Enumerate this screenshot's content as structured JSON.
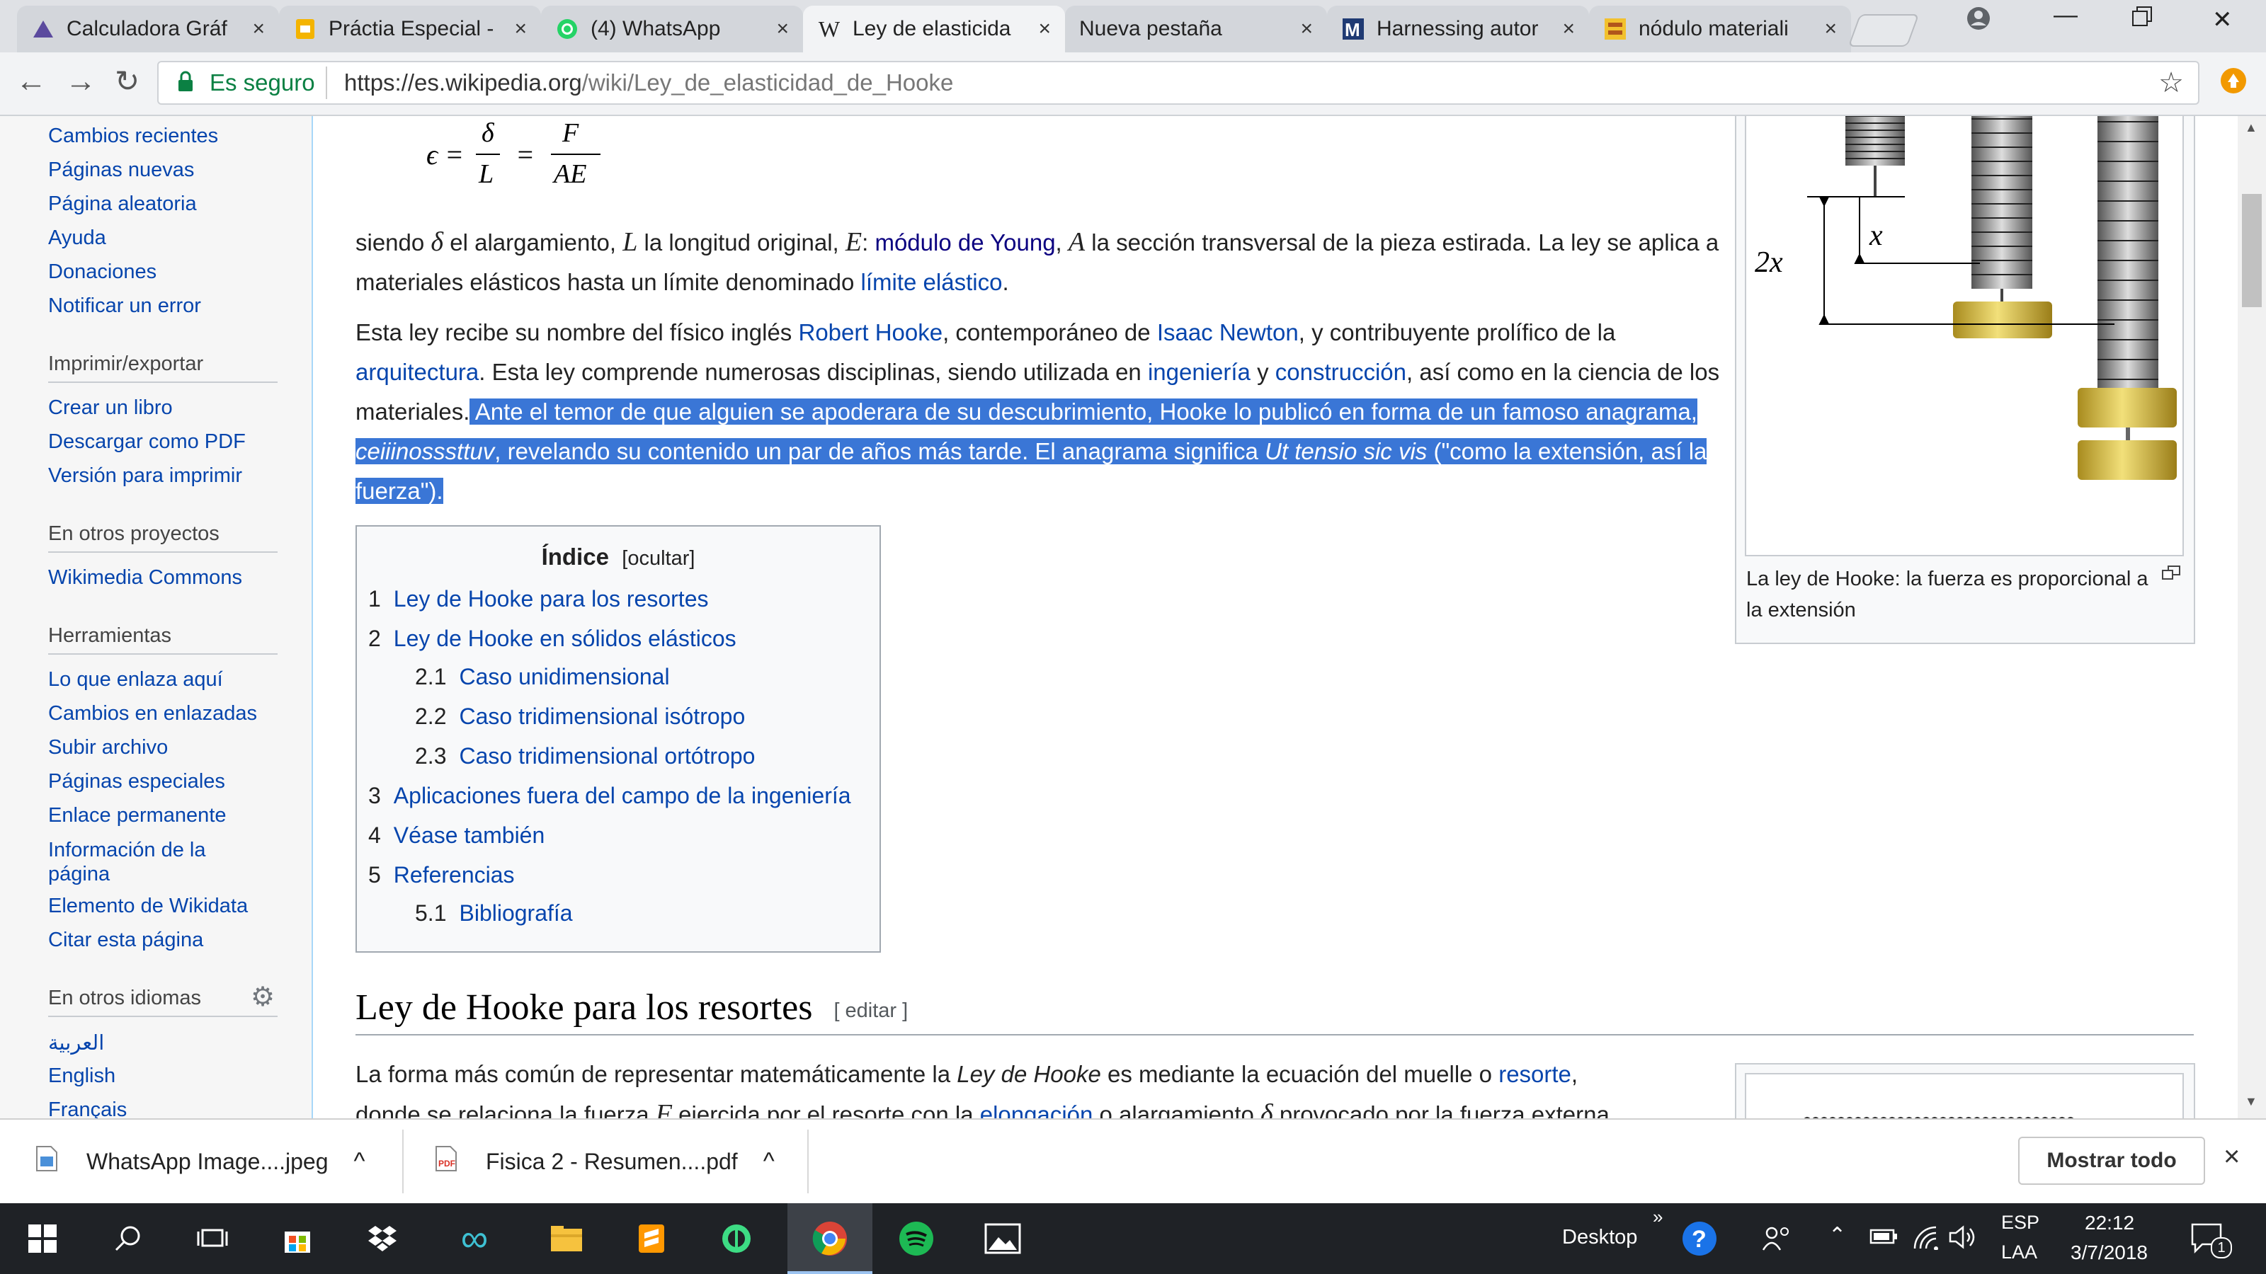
{
  "browser": {
    "tabs": [
      {
        "title": "Calculadora Gráf",
        "icon": "desmos-icon"
      },
      {
        "title": "Práctia Especial -",
        "icon": "slides-icon"
      },
      {
        "title": "(4) WhatsApp",
        "icon": "whatsapp-icon"
      },
      {
        "title": "Ley de elasticida",
        "icon": "wikipedia-icon",
        "active": true
      },
      {
        "title": "Nueva pestaña",
        "icon": ""
      },
      {
        "title": "Harnessing autor",
        "icon": "mdpi-icon"
      },
      {
        "title": "nódulo materiali",
        "icon": "nodmat-icon"
      }
    ],
    "secure_label": "Es seguro",
    "url_host": "https://es.wikipedia.org",
    "url_path": "/wiki/Ley_de_elasticidad_de_Hooke",
    "close_glyph": "×"
  },
  "sidebar": {
    "top_links": [
      "Cambios recientes",
      "Páginas nuevas",
      "Página aleatoria",
      "Ayuda",
      "Donaciones",
      "Notificar un error"
    ],
    "print_heading": "Imprimir/exportar",
    "print_links": [
      "Crear un libro",
      "Descargar como PDF",
      "Versión para imprimir"
    ],
    "projects_heading": "En otros proyectos",
    "projects_links": [
      "Wikimedia Commons"
    ],
    "tools_heading": "Herramientas",
    "tools_links": [
      "Lo que enlaza aquí",
      "Cambios en enlazadas",
      "Subir archivo",
      "Páginas especiales",
      "Enlace permanente",
      "Información de la página",
      "Elemento de Wikidata",
      "Citar esta página"
    ],
    "languages_heading": "En otros idiomas",
    "languages_links": [
      "العربية",
      "English",
      "Français"
    ]
  },
  "article": {
    "formula": "ϵ = δ/L = F/AE",
    "para1": {
      "t1": "siendo ",
      "delta": "δ",
      "t2": " el alargamiento, ",
      "L": "L",
      "t3": " la longitud original, ",
      "E": "E",
      "t4": ": ",
      "link_young": "módulo de Young",
      "t5": ", ",
      "A": "A",
      "t6": " la sección transversal de la pieza estirada. La ley se aplica a materiales elásticos hasta un límite denominado ",
      "link_limit": "límite elástico",
      "t7": "."
    },
    "para2": {
      "t1": "Esta ley recibe su nombre del físico inglés ",
      "link_hooke": "Robert Hooke",
      "t2": ", contemporáneo de ",
      "link_newton": "Isaac Newton",
      "t3": ", y contribuyente prolífico de la ",
      "link_arq": "arquitectura",
      "t4": ". Esta ley comprende numerosas disciplinas, siendo utilizada en ",
      "link_ing": "ingeniería",
      "t5": " y ",
      "link_cons": "construcción",
      "t6": ", así como en la ciencia de los materiales.",
      "hl1": " Ante el temor de que alguien se apoderara de su descubrimiento, Hooke lo publicó en forma de un famoso anagrama, ",
      "hl_italic": "ceiiinosssttuv",
      "hl2": ", revelando su contenido un par de años más tarde. El anagrama significa ",
      "hl_latin": "Ut tensio sic vis",
      "hl3": " (\"como la extensión, así la fuerza\")."
    },
    "figure": {
      "caption": "La ley de Hooke: la fuerza es proporcional a la extensión",
      "label_x": "x",
      "label_2x": "2x"
    },
    "toc": {
      "title": "Índice",
      "hide": "[ocultar]",
      "items": [
        {
          "num": "1",
          "label": "Ley de Hooke para los resortes"
        },
        {
          "num": "2",
          "label": "Ley de Hooke en sólidos elásticos"
        },
        {
          "num": "2.1",
          "label": "Caso unidimensional"
        },
        {
          "num": "2.2",
          "label": "Caso tridimensional isótropo"
        },
        {
          "num": "2.3",
          "label": "Caso tridimensional ortótropo"
        },
        {
          "num": "3",
          "label": "Aplicaciones fuera del campo de la ingeniería"
        },
        {
          "num": "4",
          "label": "Véase también"
        },
        {
          "num": "5",
          "label": "Referencias"
        },
        {
          "num": "5.1",
          "label": "Bibliografía"
        }
      ]
    },
    "section_heading": "Ley de Hooke para los resortes",
    "section_edit": "[ editar ]",
    "para3": {
      "t1": "La forma más común de representar matemáticamente la ",
      "em": "Ley de Hooke",
      "t2": " es mediante la ecuación del muelle o ",
      "link": "resorte",
      "t3": ",",
      "t4": "donde se relaciona la fuerza ",
      "F": "F",
      "t5": " ejercida por el resorte con la ",
      "link2": "elongación",
      "t6": " o alargamiento ",
      "delta": "δ",
      "t7": " provocado por la fuerza externa"
    }
  },
  "downloads": {
    "items": [
      {
        "name": "WhatsApp Image....jpeg"
      },
      {
        "name": "Fisica 2 - Resumen....pdf"
      }
    ],
    "show_all": "Mostrar todo",
    "chevron": "^",
    "close": "×"
  },
  "taskbar": {
    "desktop_label": "Desktop",
    "lang_top": "ESP",
    "lang_bottom": "LAA",
    "time": "22:12",
    "date": "3/7/2018",
    "notif_count": "1",
    "overflow": "»"
  }
}
